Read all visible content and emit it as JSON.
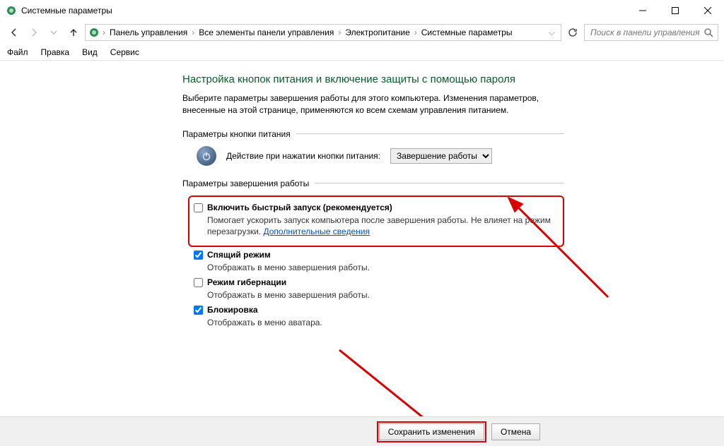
{
  "window": {
    "title": "Системные параметры"
  },
  "breadcrumb": {
    "items": [
      "Панель управления",
      "Все элементы панели управления",
      "Электропитание",
      "Системные параметры"
    ]
  },
  "search": {
    "placeholder": "Поиск в панели управления"
  },
  "menu": {
    "items": [
      "Файл",
      "Правка",
      "Вид",
      "Сервис"
    ]
  },
  "main": {
    "heading": "Настройка кнопок питания и включение защиты с помощью пароля",
    "description": "Выберите параметры завершения работы для этого компьютера. Изменения параметров, внесенные на этой странице, применяются ко всем схемам управления питанием.",
    "power_group_title": "Параметры кнопки питания",
    "power_action_label": "Действие при нажатии кнопки питания:",
    "power_action_value": "Завершение работы",
    "shutdown_group_title": "Параметры завершения работы",
    "options": {
      "fast_start": {
        "label": "Включить быстрый запуск (рекомендуется)",
        "sub_pre": "Помогает ускорить запуск компьютера после завершения работы. Не влияет на режим перезагрузки. ",
        "link": "Дополнительные сведения",
        "checked": false
      },
      "sleep": {
        "label": "Спящий режим",
        "sub": "Отображать в меню завершения работы.",
        "checked": true
      },
      "hiber": {
        "label": "Режим гибернации",
        "sub": "Отображать в меню завершения работы.",
        "checked": false
      },
      "lock": {
        "label": "Блокировка",
        "sub": "Отображать в меню аватара.",
        "checked": true
      }
    }
  },
  "footer": {
    "save": "Сохранить изменения",
    "cancel": "Отмена"
  }
}
